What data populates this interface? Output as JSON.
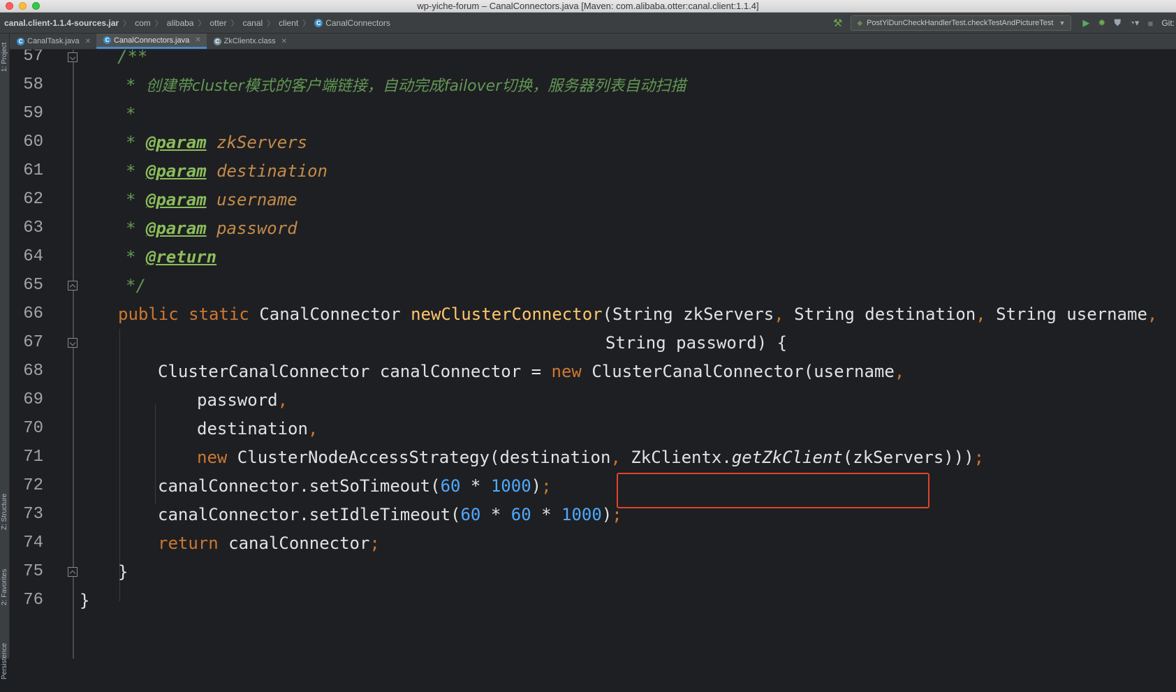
{
  "window": {
    "title": "wp-yiche-forum – CanalConnectors.java [Maven: com.alibaba.otter:canal.client:1.1.4]"
  },
  "navbar": {
    "breadcrumbs": [
      "canal.client-1.1.4-sources.jar",
      "com",
      "alibaba",
      "otter",
      "canal",
      "client",
      "CanalConnectors"
    ],
    "run_config": "PostYiDunCheckHandlerTest.checkTestAndPictureTest",
    "vcs_label": "Git:"
  },
  "tabs": [
    {
      "label": "CanalTask.java",
      "active": false,
      "icon": "class-icon"
    },
    {
      "label": "CanalConnectors.java",
      "active": true,
      "icon": "class-icon"
    },
    {
      "label": "ZkClientx.class",
      "active": false,
      "icon": "library-class-icon"
    }
  ],
  "side_panels": {
    "project": "1: Project",
    "structure": "Z: Structure",
    "favorites": "2: Favorites",
    "persistence": "Persistence"
  },
  "editor": {
    "lines": [
      {
        "number": "57"
      },
      {
        "number": "58"
      },
      {
        "number": "59"
      },
      {
        "number": "60"
      },
      {
        "number": "61"
      },
      {
        "number": "62"
      },
      {
        "number": "63"
      },
      {
        "number": "64"
      },
      {
        "number": "65"
      },
      {
        "number": "66"
      },
      {
        "number": "67"
      },
      {
        "number": "68"
      },
      {
        "number": "69"
      },
      {
        "number": "70"
      },
      {
        "number": "71"
      },
      {
        "number": "72"
      },
      {
        "number": "73"
      },
      {
        "number": "74"
      },
      {
        "number": "75"
      },
      {
        "number": "76"
      }
    ],
    "code": {
      "l57": {
        "open": "/**"
      },
      "l58": {
        "star": "* ",
        "text": "创建带cluster模式的客户端链接，自动完成failover切换，服务器列表自动扫描"
      },
      "l59": {
        "star": "*"
      },
      "l60": {
        "star": "* ",
        "tag": "@param",
        "name": "zkServers"
      },
      "l61": {
        "star": "* ",
        "tag": "@param",
        "name": "destination"
      },
      "l62": {
        "star": "* ",
        "tag": "@param",
        "name": "username"
      },
      "l63": {
        "star": "* ",
        "tag": "@param",
        "name": "password"
      },
      "l64": {
        "star": "* ",
        "tag": "@return"
      },
      "l65": {
        "close": "*/"
      },
      "l66": {
        "kw1": "public",
        "kw2": "static",
        "type": "CanalConnector",
        "method": "newClusterConnector",
        "params": "(String zkServers",
        "c1": ",",
        "p2": " String destination",
        "c2": ",",
        "p3": " String username",
        "c3": ","
      },
      "l67": {
        "text": "String password) {"
      },
      "l68": {
        "pre": "ClusterCanalConnector canalConnector = ",
        "kw": "new",
        "post": " ClusterCanalConnector(username",
        "comma": ","
      },
      "l69": {
        "text": "password",
        "comma": ","
      },
      "l70": {
        "text": "destination",
        "comma": ","
      },
      "l71": {
        "kw": "new",
        "pre": " ClusterNodeAccessStrategy(destination",
        "comma": ",",
        "cls": " ZkClientx.",
        "call": "getZkClient",
        "arg": "(zkServers)",
        "close": "))",
        "semi": ";"
      },
      "l72": {
        "pre": "canalConnector.setSoTimeout(",
        "n1": "60",
        "op": " * ",
        "n2": "1000",
        "close": ")",
        "semi": ";"
      },
      "l73": {
        "pre": "canalConnector.setIdleTimeout(",
        "n1": "60",
        "op1": " * ",
        "n2": "60",
        "op2": " * ",
        "n3": "1000",
        "close": ")",
        "semi": ";"
      },
      "l74": {
        "kw": "return",
        "text": " canalConnector",
        "semi": ";"
      },
      "l75": {
        "text": "}"
      },
      "l76": {
        "text": "}"
      }
    }
  }
}
